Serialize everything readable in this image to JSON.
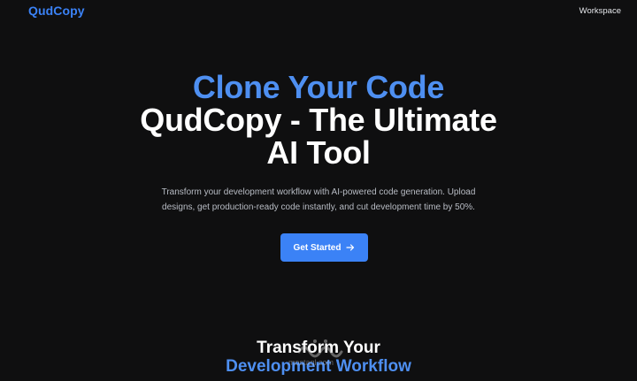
{
  "nav": {
    "brand": "QudCopy",
    "workspace_link": "Workspace"
  },
  "hero": {
    "line1": "Clone Your Code",
    "line2": "QudCopy - The Ultimate",
    "line3": "AI Tool",
    "subtitle_line1": "Transform your development workflow with AI-powered code generation. Upload",
    "subtitle_line2": "designs, get production-ready code instantly, and cut development time by 50%.",
    "cta_label": "Get Started",
    "cta_icon": "arrow-right-icon"
  },
  "section": {
    "heading_line1": "Transform Your",
    "heading_line2": "Development Workflow"
  },
  "watermark": {
    "text": "mostaql.com"
  },
  "colors": {
    "background": "#0f0f10",
    "accent": "#3b82f6",
    "heading_accent": "#4e8ff1",
    "subtitle": "#b8bcc4"
  }
}
